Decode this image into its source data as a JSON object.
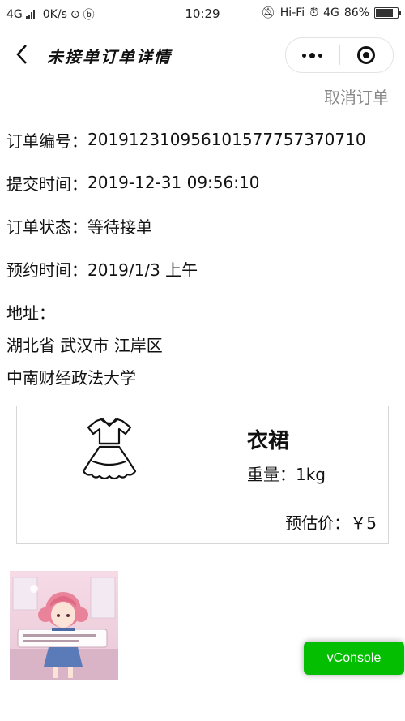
{
  "statusbar": {
    "network": "4G",
    "speed": "0K/s",
    "time": "10:29",
    "wifi": "Hi-Fi",
    "net2": "4G",
    "battery": "86%",
    "battery_level": 0.86
  },
  "navbar": {
    "title": "未接单订单详情"
  },
  "actions": {
    "cancel_label": "取消订单"
  },
  "order": {
    "number_label": "订单编号：",
    "number": "201912310956101577757370710",
    "submit_label": "提交时间：",
    "submit_time": "2019-12-31 09:56:10",
    "status_label": "订单状态：",
    "status": "等待接单",
    "appoint_label": "预约时间：",
    "appoint_time": "2019/1/3 上午",
    "address_label": "地址：",
    "address_line1": "湖北省 武汉市 江岸区",
    "address_line2": "中南财经政法大学"
  },
  "item": {
    "icon": "dress-icon",
    "name": "衣裙",
    "weight": "重量：1kg",
    "price": "预估价：￥5"
  },
  "vconsole": {
    "label": "vConsole"
  }
}
